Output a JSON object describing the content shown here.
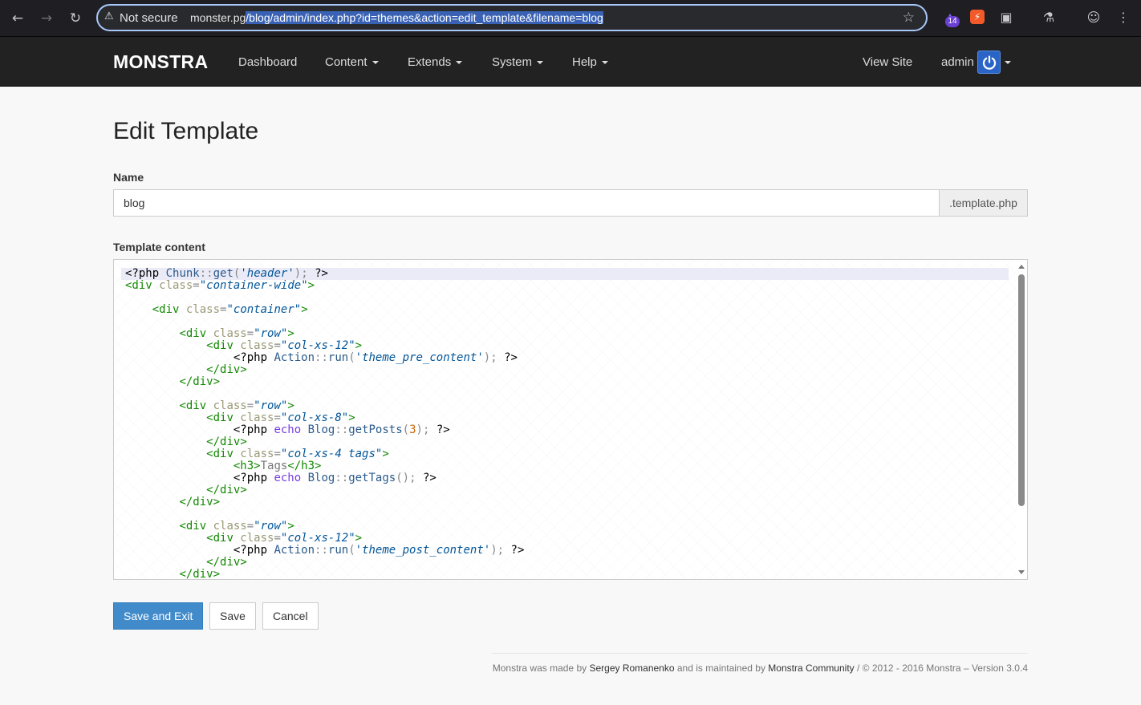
{
  "browser": {
    "security_label": "Not secure",
    "url_host": "monster.pg",
    "url_path": "/blog/admin/index.php?id=themes&action=edit_template&filename=blog",
    "extension_badge_count": "14"
  },
  "navbar": {
    "brand": "MONSTRA",
    "items": [
      {
        "label": "Dashboard"
      },
      {
        "label": "Content"
      },
      {
        "label": "Extends"
      },
      {
        "label": "System"
      },
      {
        "label": "Help"
      }
    ],
    "view_site": "View Site",
    "user": "admin"
  },
  "page": {
    "title": "Edit Template",
    "name_label": "Name",
    "name_value": "blog",
    "name_suffix": ".template.php",
    "content_label": "Template content"
  },
  "editor": {
    "lines": [
      "<?php Chunk::get('header'); ?>",
      "<div class=\"container-wide\">",
      "",
      "    <div class=\"container\">",
      "",
      "        <div class=\"row\">",
      "            <div class=\"col-xs-12\">",
      "                <?php Action::run('theme_pre_content'); ?>",
      "            </div>",
      "        </div>",
      "",
      "        <div class=\"row\">",
      "            <div class=\"col-xs-8\">",
      "                <?php echo Blog::getPosts(3); ?>",
      "            </div>",
      "            <div class=\"col-xs-4 tags\">",
      "                <h3>Tags</h3>",
      "                <?php echo Blog::getTags(); ?>",
      "            </div>",
      "        </div>",
      "",
      "        <div class=\"row\">",
      "            <div class=\"col-xs-12\">",
      "                <?php Action::run('theme_post_content'); ?>",
      "            </div>",
      "        </div>"
    ]
  },
  "buttons": {
    "save_exit": "Save and Exit",
    "save": "Save",
    "cancel": "Cancel"
  },
  "footer": {
    "prefix": "Monstra was made by",
    "author": "Sergey Romanenko",
    "middle": "and is maintained by",
    "community": "Monstra Community",
    "suffix": "/ © 2012 - 2016 Monstra – Version 3.0.4"
  },
  "colors": {
    "navbar_bg": "#222222",
    "primary": "#428bca",
    "page_bg": "#f8f8f8"
  }
}
